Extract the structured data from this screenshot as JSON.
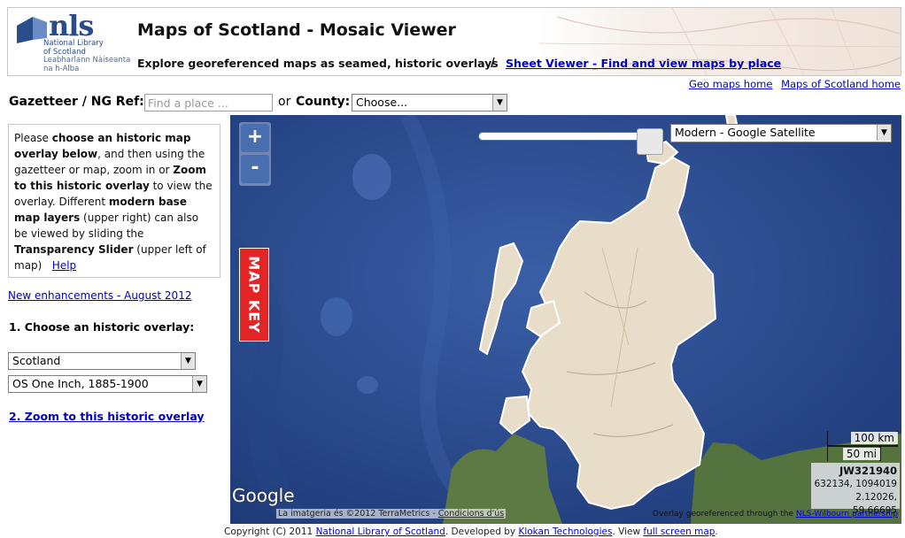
{
  "header": {
    "logo_text": "nls",
    "logo_sub_lines": [
      "National Library",
      "of Scotland"
    ],
    "logo_gaelic_lines": [
      "Leabharlann Nàiseanta",
      "na h-Alba"
    ],
    "title": "Maps of Scotland - Mosaic Viewer",
    "subtitle": "Explore georeferenced maps as seamed, historic overlays",
    "separator": "/",
    "sheet_viewer_link": "Sheet Viewer - Find and view maps by place"
  },
  "top_links": {
    "geo_maps_home": "Geo maps home",
    "maps_of_scotland_home": "Maps of Scotland home"
  },
  "search": {
    "gazetteer_label": "Gazetteer / NG Ref:",
    "place_placeholder": "Find a place ...",
    "or_label": "or",
    "county_label": "County:",
    "county_value": "Choose..."
  },
  "info": {
    "p1": "Please ",
    "b1": "choose an historic map overlay below",
    "p2": ", and then using the gazetteer or map, zoom in or ",
    "b2": "Zoom to this historic overlay",
    "p3": " to view the overlay. Different ",
    "b3": "modern base map layers",
    "p4": " (upper right) can also be viewed by sliding the ",
    "b4": "Transparency Slider",
    "p5": " (upper left of map)",
    "help_link": "Help"
  },
  "enhancements_link": "New enhancements - August 2012",
  "choose_overlay_label": "1. Choose an historic overlay:",
  "overlay_region": "Scotland",
  "overlay_series": "OS One Inch, 1885-1900",
  "zoom_overlay_link": "2. Zoom to this historic overlay",
  "map": {
    "zoom_in": "+",
    "zoom_out": "-",
    "base_layer": "Modern - Google Satellite",
    "transparency": 1.0,
    "map_key": "MAP KEY",
    "scale_km": "100 km",
    "scale_mi": "50 mi",
    "grid_ref": "JW321940",
    "easting_northing": "632134, 1094019",
    "lonlat": "2.12026, 59.66695",
    "google_logo": "Google",
    "attribution_text": "La imatgeria és ©2012 TerraMetrics - ",
    "attribution_link": "Condicions d'ús",
    "overlay_note_text": "Overlay georeferenced through the ",
    "overlay_note_link": "NLS-Wilbourn partnership"
  },
  "footer": {
    "t1": "Copyright (C) 2011 ",
    "link1": "National Library of Scotland",
    "t2": ". Developed by ",
    "link2": "Klokan Technologies",
    "t3": ". View ",
    "link3": "full screen map",
    "t4": "."
  },
  "colors": {
    "sea": "#2b4a8a",
    "land": "#e7ddc8",
    "map_key": "#e42525",
    "link": "#0000cc",
    "logo": "#2a4c8a"
  }
}
